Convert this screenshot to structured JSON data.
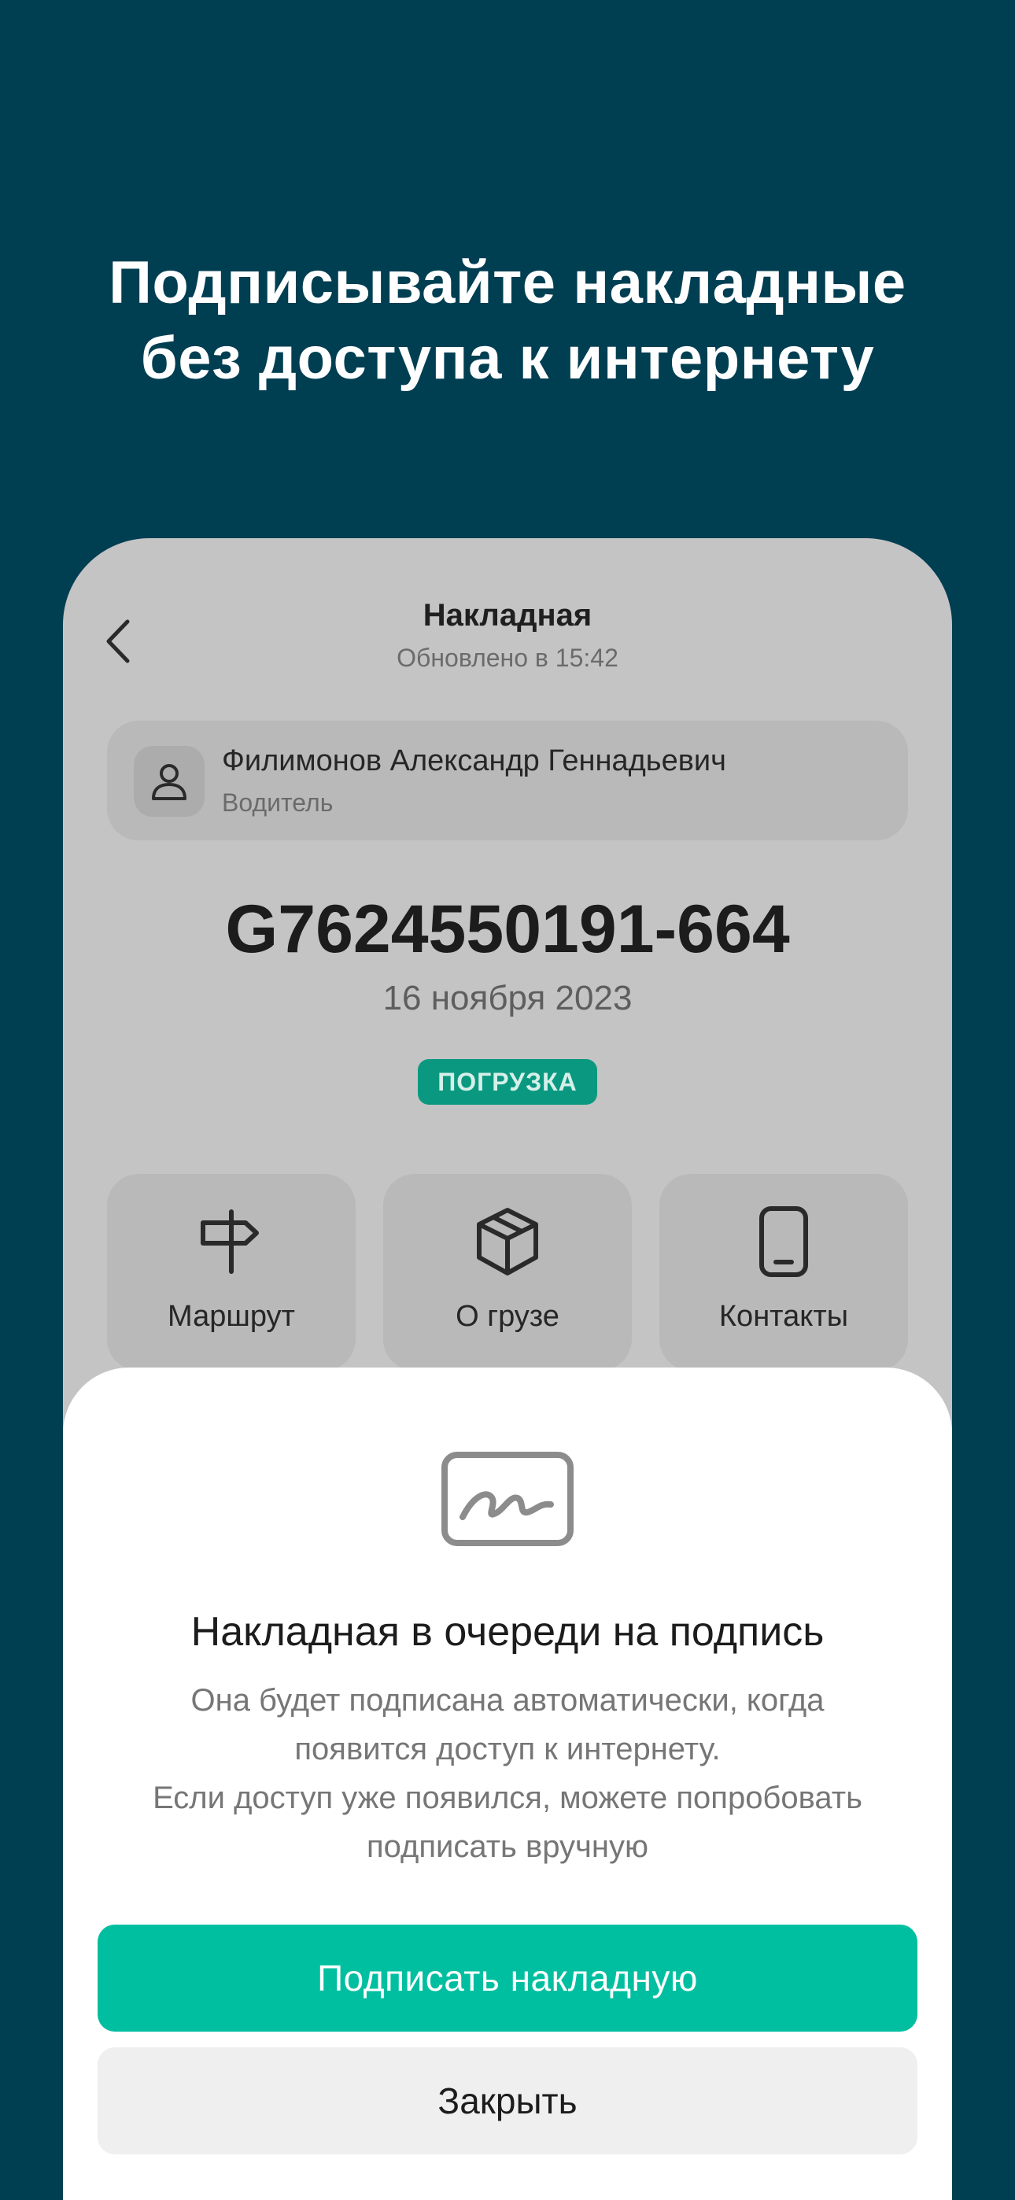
{
  "promo": {
    "title_line1": "Подписывайте накладные",
    "title_line2": "без доступа к интернету"
  },
  "screen": {
    "title": "Накладная",
    "subtitle": "Обновлено в 15:42"
  },
  "driver": {
    "name": "Филимонов Александр Геннадьевич",
    "role": "Водитель",
    "icon": "person-icon"
  },
  "document": {
    "number": "G7624550191-664",
    "date": "16 ноября 2023",
    "status": "ПОГРУЗКА"
  },
  "actions": [
    {
      "label": "Маршрут",
      "icon": "signpost-icon"
    },
    {
      "label": "О грузе",
      "icon": "box-icon"
    },
    {
      "label": "Контакты",
      "icon": "phone-icon"
    }
  ],
  "sheet": {
    "icon": "signature-icon",
    "title": "Накладная в очереди на подпись",
    "desc_line1": "Она будет подписана автоматически, когда",
    "desc_line2": "появится доступ к интернету.",
    "desc_line3": "Если доступ уже появился, можете попробовать",
    "desc_line4": "подписать вручную",
    "sign_label": "Подписать накладную",
    "close_label": "Закрыть"
  },
  "colors": {
    "background": "#003e52",
    "accent": "#00bfa0",
    "status_badge": "#0a9980"
  }
}
